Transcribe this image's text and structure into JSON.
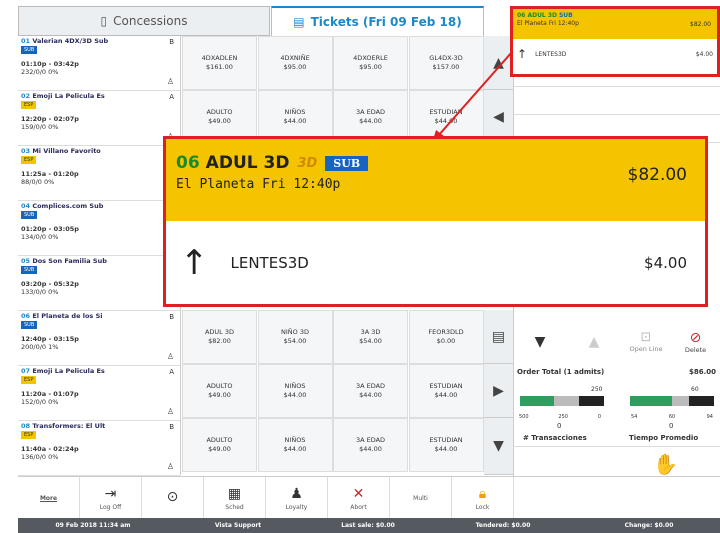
{
  "tabs": {
    "concessions": "Concessions",
    "tickets": "Tickets (Fri 09 Feb 18)"
  },
  "films": [
    {
      "num": "01",
      "name": "Valerian 4DX/3D Sub",
      "rating": "B",
      "badge": "SUB",
      "time": "01:10p - 03:42p",
      "stats": "232/0/0  0%"
    },
    {
      "num": "02",
      "name": "Emoji La Pelicula Es",
      "rating": "A",
      "badge": "ESP",
      "time": "12:20p - 02:07p",
      "stats": "159/0/0  0%"
    },
    {
      "num": "03",
      "name": "Mi Villano Favorito",
      "rating": "",
      "badge": "ESP",
      "time": "11:25a - 01:20p",
      "stats": "88/0/0  0%"
    },
    {
      "num": "04",
      "name": "Complices.com Sub",
      "rating": "",
      "badge": "SUB",
      "time": "01:20p - 03:05p",
      "stats": "134/0/0  0%"
    },
    {
      "num": "05",
      "name": "Dos Son Familia Sub",
      "rating": "",
      "badge": "SUB",
      "time": "03:20p - 05:32p",
      "stats": "133/0/0  0%"
    },
    {
      "num": "06",
      "name": "El Planeta de los Si",
      "rating": "B",
      "badge": "SUB",
      "time": "12:40p - 03:15p",
      "stats": "200/0/0  1%"
    },
    {
      "num": "07",
      "name": "Emoji La Pelicula Es",
      "rating": "A",
      "badge": "ESP",
      "time": "11:20a - 01:07p",
      "stats": "152/0/0  0%"
    },
    {
      "num": "08",
      "name": "Transformers: El Ult",
      "rating": "B",
      "badge": "ESP",
      "time": "11:40a - 02:24p",
      "stats": "136/0/0  0%"
    }
  ],
  "prices": [
    [
      {
        "n": "4DXADLEN",
        "p": "$161.00"
      },
      {
        "n": "4DXNIÑE",
        "p": "$95.00"
      },
      {
        "n": "4DXOERLE",
        "p": "$95.00"
      },
      {
        "n": "GL4DX-3D",
        "p": "$157.00"
      }
    ],
    [
      {
        "n": "ADULTO",
        "p": "$49.00"
      },
      {
        "n": "NIÑOS",
        "p": "$44.00"
      },
      {
        "n": "3A EDAD",
        "p": "$44.00"
      },
      {
        "n": "ESTUDIAN",
        "p": "$44.00"
      }
    ],
    [
      {
        "n": "ADUL 3D",
        "p": "$82.00"
      },
      {
        "n": "NIÑO 3D",
        "p": "$54.00"
      },
      {
        "n": "3A 3D",
        "p": "$54.00"
      },
      {
        "n": "FEOR3DLD",
        "p": "$0.00"
      }
    ],
    [
      {
        "n": "ADULTO",
        "p": "$49.00"
      },
      {
        "n": "NIÑOS",
        "p": "$44.00"
      },
      {
        "n": "3A EDAD",
        "p": "$44.00"
      },
      {
        "n": "ESTUDIAN",
        "p": "$44.00"
      }
    ],
    [
      {
        "n": "ADULTO",
        "p": "$49.00"
      },
      {
        "n": "NIÑOS",
        "p": "$44.00"
      },
      {
        "n": "3A EDAD",
        "p": "$44.00"
      },
      {
        "n": "ESTUDIAN",
        "p": "$44.00"
      }
    ]
  ],
  "cart_small": {
    "line1": "06 ADUL 3D",
    "line2": "El Planeta Fri 12:40p",
    "price": "$82.00",
    "item": "LENTES3D",
    "item_price": "$4.00",
    "sub": "SUB"
  },
  "cart_big": {
    "num": "06",
    "title": "ADUL 3D",
    "badge3d": "3D",
    "sub": "SUB",
    "subtitle": "El Planeta Fri 12:40p",
    "price": "$82.00",
    "item": "LENTES3D",
    "item_price": "$4.00"
  },
  "controls": {
    "open_line": "Open Line",
    "delete": "Delete"
  },
  "order": {
    "label": "Order Total (1 admits)",
    "total": "$86.00",
    "meter1_labels": [
      "500",
      "250",
      "0"
    ],
    "meter1_val": "250",
    "meter2_labels": [
      "54",
      "60",
      "94"
    ],
    "meter2_val": "60",
    "zero": "0",
    "trans": "# Transacciones",
    "tiempo": "Tiempo Promedio"
  },
  "toolbar": {
    "more": "More",
    "logoff": "Log Off",
    "sched": "Sched",
    "loyalty": "Loyalty",
    "abort": "Abort",
    "multi": "Multi",
    "lock": "Lock"
  },
  "status": {
    "date": "09 Feb 2018 11:34 am",
    "support": "Vista Support",
    "last": "Last sale: $0.00",
    "tendered": "Tendered: $0.00",
    "change": "Change: $0.00"
  }
}
